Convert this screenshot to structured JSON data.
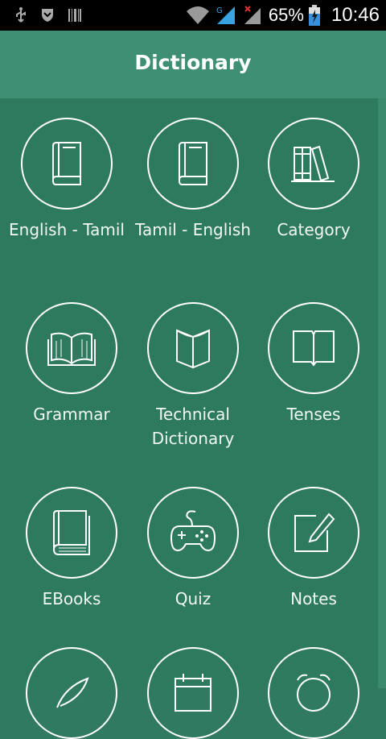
{
  "status_bar": {
    "battery_percent": "65%",
    "time": "10:46",
    "network_letter": "G"
  },
  "app": {
    "title": "Dictionary"
  },
  "menu": {
    "english_tamil": "English - Tamil",
    "tamil_english": "Tamil - English",
    "category": "Category",
    "grammar": "Grammar",
    "technical_dictionary": "Technical Dictionary",
    "tenses": "Tenses",
    "ebooks": "EBooks",
    "quiz": "Quiz",
    "notes": "Notes"
  },
  "colors": {
    "background": "#2f7a61",
    "appbar": "#3e8f74",
    "statusbar": "#000000",
    "icon_stroke": "#ffffff"
  }
}
